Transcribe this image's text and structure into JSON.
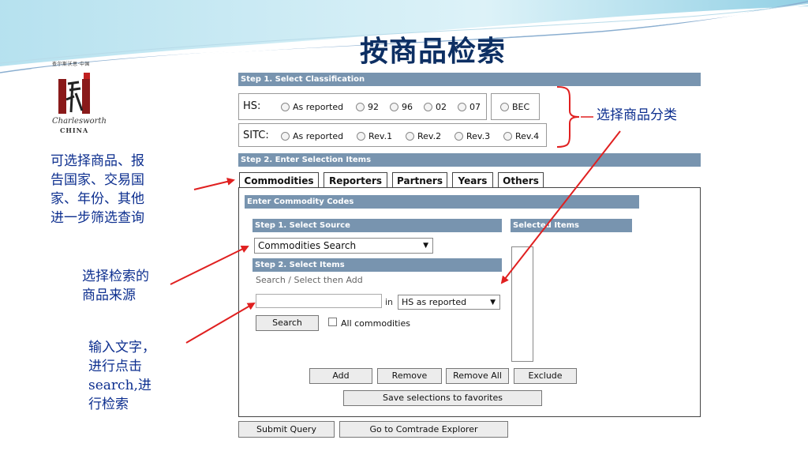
{
  "slide": {
    "title": "按商品检索",
    "logo": {
      "caption": "查尔斯沃思·中国",
      "script": "Charlesworth",
      "china": "CHINA"
    }
  },
  "classification": {
    "header": "Step 1. Select Classification",
    "hs": {
      "label": "HS:",
      "options": [
        "As reported",
        "92",
        "96",
        "02",
        "07"
      ],
      "bec": "BEC"
    },
    "sitc": {
      "label": "SITC:",
      "options": [
        "As reported",
        "Rev.1",
        "Rev.2",
        "Rev.3",
        "Rev.4"
      ]
    }
  },
  "selection": {
    "header": "Step 2. Enter Selection Items",
    "tabs": [
      "Commodities",
      "Reporters",
      "Partners",
      "Years",
      "Others"
    ],
    "enter_codes_header": "Enter Commodity Codes",
    "source_header": "Step 1. Select Source",
    "source_value": "Commodities Search",
    "items_header": "Step 2. Select Items",
    "search_hint": "Search / Select then Add",
    "search_value": "",
    "in_label": "in",
    "search_scope": "HS as reported",
    "search_button": "Search",
    "all_commodities": "All commodities",
    "selected_items_header": "Selected Items",
    "buttons": {
      "add": "Add",
      "remove": "Remove",
      "remove_all": "Remove All",
      "exclude": "Exclude",
      "save": "Save selections  to favorites"
    }
  },
  "footer": {
    "submit": "Submit Query",
    "explorer": "Go to Comtrade Explorer"
  },
  "annotations": {
    "classification_note": "选择商品分类",
    "tabs_note": [
      "可选择商品、报",
      "告国家、交易国",
      "家、年份、其他",
      "进一步筛选查询"
    ],
    "source_note": [
      "选择检索的",
      "商品来源"
    ],
    "search_note": [
      "输入文字，",
      "进行点击",
      "search,进",
      "行检索"
    ]
  },
  "colors": {
    "band": "#7894af",
    "title": "#0d2f63",
    "note_text": "#0d2f8f",
    "arrow": "#e02020"
  }
}
